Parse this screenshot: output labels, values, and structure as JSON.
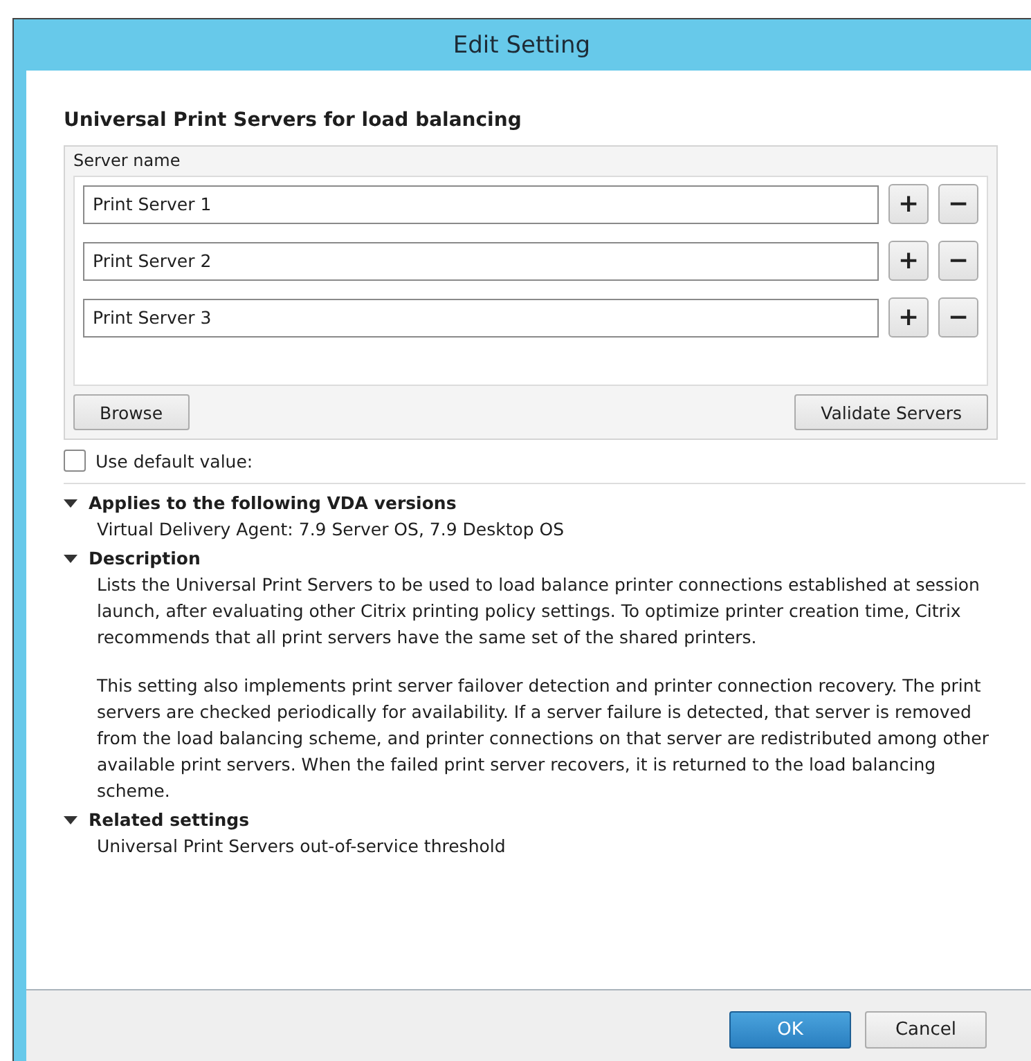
{
  "window": {
    "title": "Edit Setting"
  },
  "heading": "Universal Print Servers for load balancing",
  "server_list": {
    "label": "Server name",
    "servers": [
      {
        "value": "Print Server 1",
        "add": "+",
        "remove": "−"
      },
      {
        "value": "Print Server 2",
        "add": "+",
        "remove": "−"
      },
      {
        "value": "Print Server 3",
        "add": "+",
        "remove": "−"
      }
    ],
    "browse_button": "Browse",
    "validate_button": "Validate Servers"
  },
  "use_default": {
    "label": "Use default value:",
    "checked": false
  },
  "sections": [
    {
      "title": "Applies to the following VDA versions",
      "expanded": true,
      "paragraphs": [
        "Virtual Delivery Agent: 7.9 Server OS, 7.9 Desktop OS"
      ]
    },
    {
      "title": "Description",
      "expanded": true,
      "paragraphs": [
        "Lists the Universal Print Servers to be used to load balance printer connections established at session launch, after evaluating other Citrix printing policy settings.  To optimize printer creation time, Citrix recommends that all print servers have the same set of the shared printers.",
        "This setting also implements print server failover detection and printer connection recovery. The print servers are checked periodically for availability. If a server failure is detected, that server is removed from the load balancing scheme, and printer connections on that server are redistributed among other available print servers. When the failed print server recovers, it is returned to the load balancing scheme."
      ]
    },
    {
      "title": "Related settings",
      "expanded": true,
      "paragraphs": [
        "Universal Print Servers out-of-service threshold"
      ]
    }
  ],
  "buttons": [
    {
      "label": "OK",
      "kind": "primary"
    },
    {
      "label": "Cancel",
      "kind": "secondary"
    }
  ]
}
